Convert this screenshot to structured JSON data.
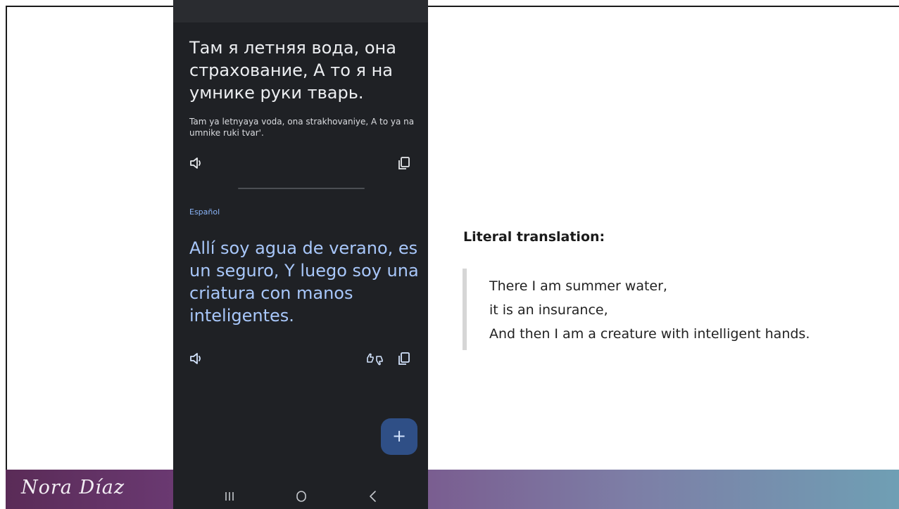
{
  "slide": {
    "signature": "Nora Díaz"
  },
  "phone": {
    "source": {
      "text": "Там я летняя вода, она страхование, А то я на умнике руки тварь.",
      "transliteration": "Tam ya letnyaya voda, ona strakhovaniye, A to ya na umnike ruki tvar'.",
      "icons": {
        "speaker": "speaker-icon",
        "copy": "copy-icon"
      }
    },
    "target": {
      "language": "Español",
      "text": "Allí soy agua de verano, es un seguro, Y luego soy una criatura con manos inteligentes.",
      "icons": {
        "speaker": "speaker-icon",
        "rating": "thumbs-up-down-icon",
        "copy": "copy-icon"
      }
    },
    "fab_label": "+",
    "nav": {
      "recent": "recent-apps-icon",
      "home": "home-icon",
      "back": "back-icon"
    },
    "colors": {
      "background": "#1f2125",
      "source_text": "#eceef1",
      "target_text": "#a8c7fa",
      "language_label": "#8ab4f8",
      "fab": "#2f4f86"
    }
  },
  "literal": {
    "heading": "Literal translation:",
    "lines": [
      "There I am summer water,",
      "it is an insurance,",
      "And then I am a creature with intelligent hands."
    ]
  }
}
